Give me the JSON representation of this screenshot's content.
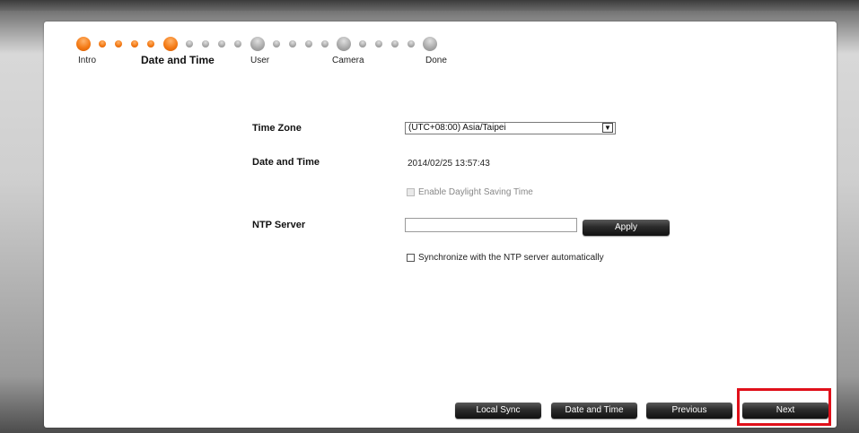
{
  "steps": [
    {
      "label": "Intro",
      "state": "completed"
    },
    {
      "label": "Date and Time",
      "state": "current"
    },
    {
      "label": "User",
      "state": "pending"
    },
    {
      "label": "Camera",
      "state": "pending"
    },
    {
      "label": "Done",
      "state": "pending"
    }
  ],
  "form": {
    "time_zone_label": "Time Zone",
    "time_zone_value": "(UTC+08:00) Asia/Taipei",
    "date_time_label": "Date and Time",
    "date_time_value": "2014/02/25 13:57:43",
    "daylight_saving_label": "Enable Daylight Saving Time",
    "ntp_server_label": "NTP Server",
    "ntp_server_value": "",
    "apply_label": "Apply",
    "sync_label": "Synchronize with the NTP server automatically"
  },
  "footer": {
    "local_sync_label": "Local Sync",
    "date_time_label": "Date and Time",
    "previous_label": "Previous",
    "next_label": "Next"
  },
  "colors": {
    "step_completed": "#f47b16",
    "step_pending": "#a7a7a7",
    "highlight": "#e0101a"
  }
}
